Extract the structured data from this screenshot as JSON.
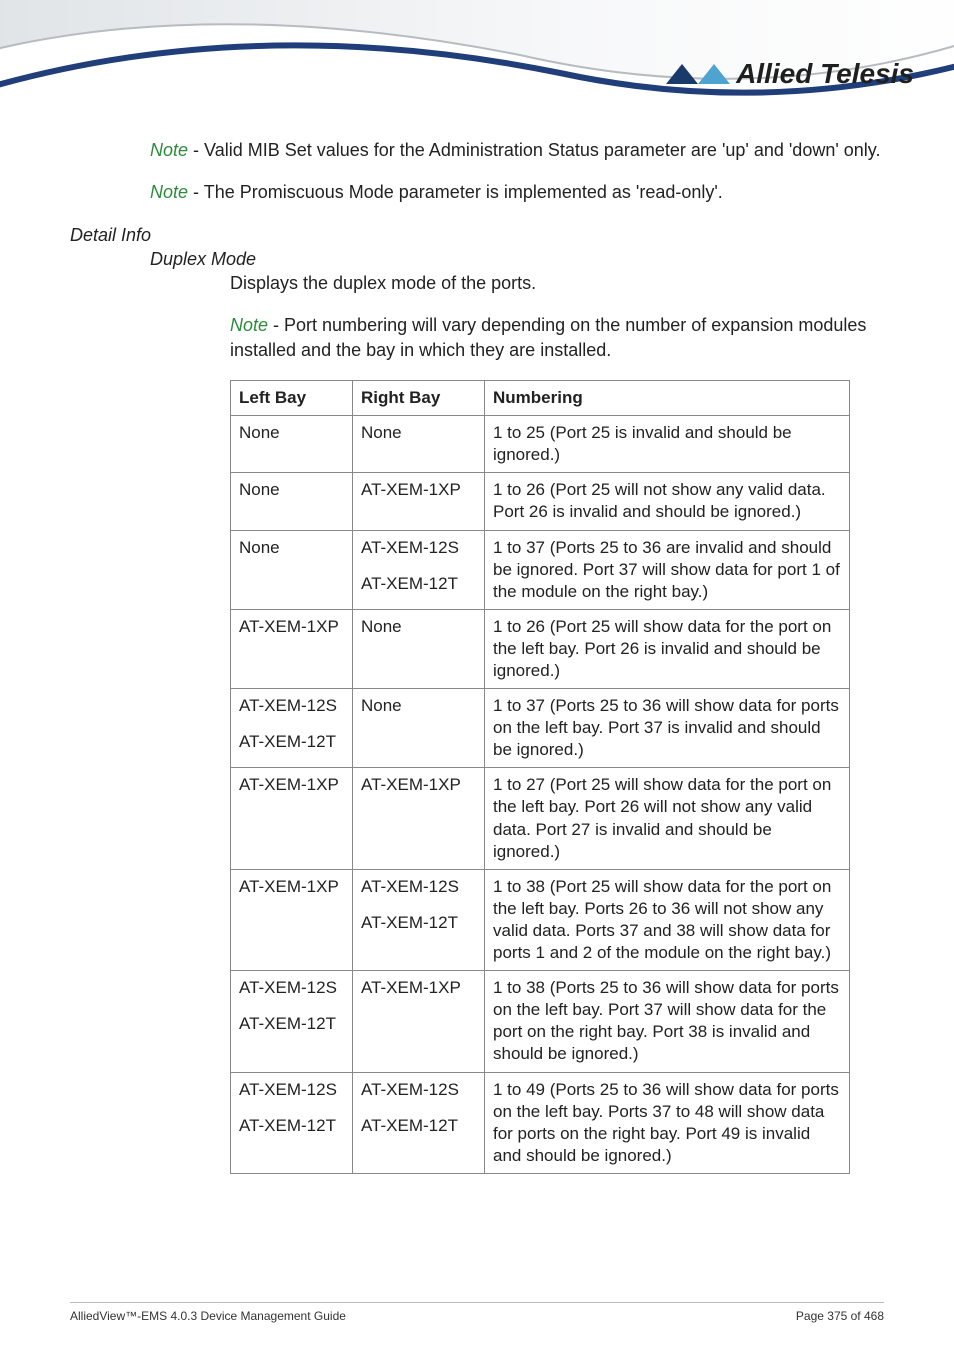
{
  "brand": "Allied Telesis",
  "notes": {
    "n1_prefix": "Note",
    "n1_body": " - Valid MIB Set values for the Administration Status parameter are 'up' and 'down' only.",
    "n2_prefix": "Note",
    "n2_body": " - The Promiscuous Mode parameter is implemented as 'read-only'.",
    "n3_prefix": "Note",
    "n3_body": " - Port numbering will vary depending on the number of expansion modules installed and the bay in which they are installed."
  },
  "labels": {
    "detail_info": "Detail Info",
    "duplex_mode": "Duplex Mode",
    "duplex_desc": "Displays the duplex mode of the ports."
  },
  "table": {
    "headers": {
      "left": "Left Bay",
      "right": "Right Bay",
      "num": "Numbering"
    },
    "rows": [
      {
        "left": [
          "None"
        ],
        "right": [
          "None"
        ],
        "num": "1 to 25 (Port 25 is invalid and should be ignored.)"
      },
      {
        "left": [
          "None"
        ],
        "right": [
          "AT-XEM-1XP"
        ],
        "num": "1 to 26 (Port 25 will not show any valid data. Port 26 is invalid and should be ignored.)"
      },
      {
        "left": [
          "None"
        ],
        "right": [
          "AT-XEM-12S",
          "AT-XEM-12T"
        ],
        "num": "1 to 37 (Ports 25 to 36 are invalid and should be ignored. Port 37 will show data for port 1 of the module on the right bay.)"
      },
      {
        "left": [
          "AT-XEM-1XP"
        ],
        "right": [
          "None"
        ],
        "num": "1 to 26 (Port 25 will show data for the port on the left bay. Port 26 is invalid and should be ignored.)"
      },
      {
        "left": [
          "AT-XEM-12S",
          "AT-XEM-12T"
        ],
        "right": [
          "None"
        ],
        "num": "1 to 37 (Ports 25 to 36 will show data for ports on the left bay. Port 37 is invalid and should be ignored.)"
      },
      {
        "left": [
          "AT-XEM-1XP"
        ],
        "right": [
          "AT-XEM-1XP"
        ],
        "num": "1 to 27 (Port 25 will show data for the port on the left bay. Port 26 will not show any valid data. Port 27 is invalid and should be ignored.)"
      },
      {
        "left": [
          "AT-XEM-1XP"
        ],
        "right": [
          "AT-XEM-12S",
          "AT-XEM-12T"
        ],
        "num": "1 to 38 (Port 25 will show data for the port on the left bay. Ports 26 to 36 will not show any valid data. Ports 37 and 38 will show data for ports 1 and 2 of the module on the right bay.)"
      },
      {
        "left": [
          "AT-XEM-12S",
          "AT-XEM-12T"
        ],
        "right": [
          "AT-XEM-1XP"
        ],
        "num": "1 to 38 (Ports 25 to 36 will show data for ports on the left bay. Port 37 will show data for the port on the right bay. Port 38 is invalid and should be ignored.)"
      },
      {
        "left": [
          "AT-XEM-12S",
          "AT-XEM-12T"
        ],
        "right": [
          "AT-XEM-12S",
          "AT-XEM-12T"
        ],
        "num": "1 to 49 (Ports 25 to 36 will show data for ports on the left bay. Ports 37 to 48 will show data for ports on the right bay. Port 49 is invalid and should be ignored.)"
      }
    ]
  },
  "footer": {
    "left": "AlliedView™-EMS 4.0.3 Device Management Guide",
    "right": "Page 375 of 468"
  }
}
